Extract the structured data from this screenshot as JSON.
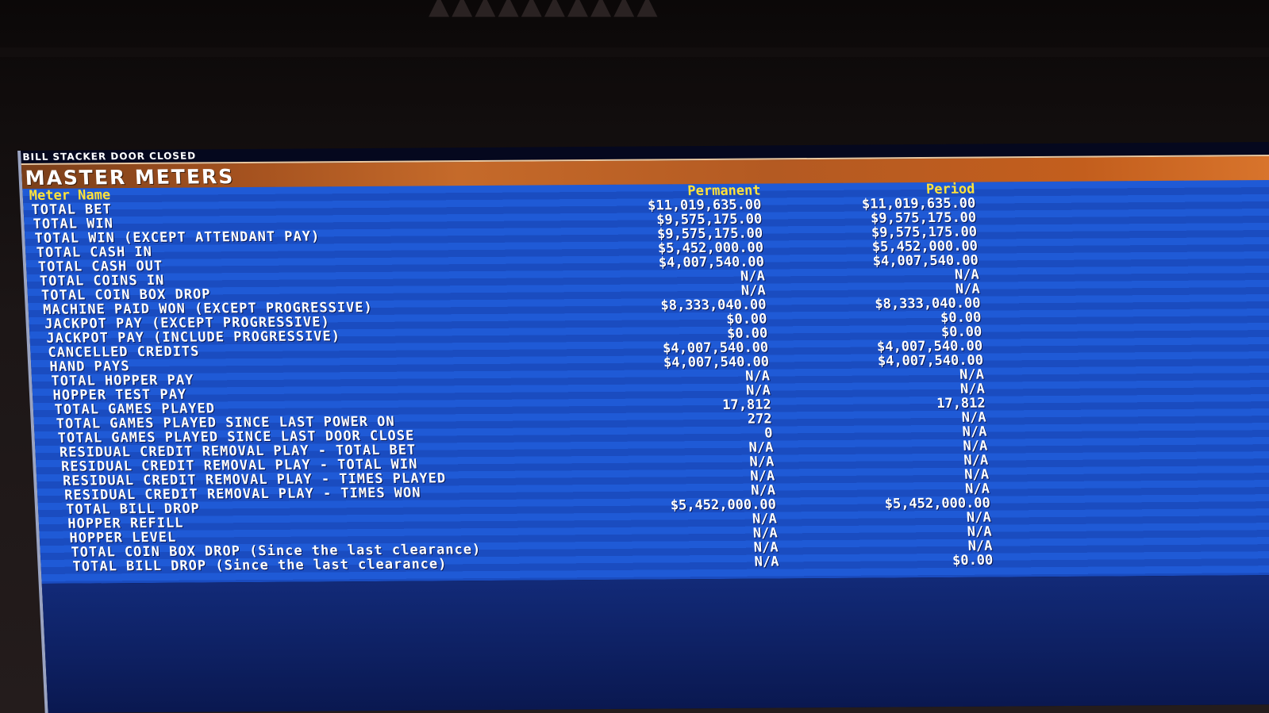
{
  "status": "BILL STACKER DOOR CLOSED",
  "title": "MASTER METERS",
  "columns": {
    "name": "Meter Name",
    "permanent": "Permanent",
    "period": "Period"
  },
  "meters": [
    {
      "name": "TOTAL BET",
      "permanent": "$11,019,635.00",
      "period": "$11,019,635.00"
    },
    {
      "name": "TOTAL WIN",
      "permanent": "$9,575,175.00",
      "period": "$9,575,175.00"
    },
    {
      "name": "TOTAL WIN (EXCEPT ATTENDANT PAY)",
      "permanent": "$9,575,175.00",
      "period": "$9,575,175.00"
    },
    {
      "name": "TOTAL CASH IN",
      "permanent": "$5,452,000.00",
      "period": "$5,452,000.00"
    },
    {
      "name": "TOTAL CASH OUT",
      "permanent": "$4,007,540.00",
      "period": "$4,007,540.00"
    },
    {
      "name": "TOTAL COINS IN",
      "permanent": "N/A",
      "period": "N/A"
    },
    {
      "name": "TOTAL COIN BOX DROP",
      "permanent": "N/A",
      "period": "N/A"
    },
    {
      "name": "MACHINE PAID WON (EXCEPT PROGRESSIVE)",
      "permanent": "$8,333,040.00",
      "period": "$8,333,040.00"
    },
    {
      "name": "JACKPOT PAY (EXCEPT PROGRESSIVE)",
      "permanent": "$0.00",
      "period": "$0.00"
    },
    {
      "name": "JACKPOT PAY (INCLUDE PROGRESSIVE)",
      "permanent": "$0.00",
      "period": "$0.00"
    },
    {
      "name": "CANCELLED CREDITS",
      "permanent": "$4,007,540.00",
      "period": "$4,007,540.00"
    },
    {
      "name": "HAND PAYS",
      "permanent": "$4,007,540.00",
      "period": "$4,007,540.00"
    },
    {
      "name": "TOTAL HOPPER PAY",
      "permanent": "N/A",
      "period": "N/A"
    },
    {
      "name": "HOPPER TEST PAY",
      "permanent": "N/A",
      "period": "N/A"
    },
    {
      "name": "TOTAL GAMES PLAYED",
      "permanent": "17,812",
      "period": "17,812"
    },
    {
      "name": "TOTAL GAMES PLAYED SINCE LAST POWER ON",
      "permanent": "272",
      "period": "N/A"
    },
    {
      "name": "TOTAL GAMES PLAYED SINCE LAST DOOR CLOSE",
      "permanent": "0",
      "period": "N/A"
    },
    {
      "name": "RESIDUAL CREDIT REMOVAL PLAY - TOTAL BET",
      "permanent": "N/A",
      "period": "N/A"
    },
    {
      "name": "RESIDUAL CREDIT REMOVAL PLAY - TOTAL WIN",
      "permanent": "N/A",
      "period": "N/A"
    },
    {
      "name": "RESIDUAL CREDIT REMOVAL PLAY - TIMES PLAYED",
      "permanent": "N/A",
      "period": "N/A"
    },
    {
      "name": "RESIDUAL CREDIT REMOVAL PLAY - TIMES WON",
      "permanent": "N/A",
      "period": "N/A"
    },
    {
      "name": "TOTAL BILL DROP",
      "permanent": "$5,452,000.00",
      "period": "$5,452,000.00"
    },
    {
      "name": "HOPPER REFILL",
      "permanent": "N/A",
      "period": "N/A"
    },
    {
      "name": "HOPPER LEVEL",
      "permanent": "N/A",
      "period": "N/A"
    },
    {
      "name": "TOTAL COIN BOX DROP (Since the last clearance)",
      "permanent": "N/A",
      "period": "N/A"
    },
    {
      "name": "TOTAL BILL DROP (Since the last clearance)",
      "permanent": "N/A",
      "period": "$0.00"
    }
  ]
}
